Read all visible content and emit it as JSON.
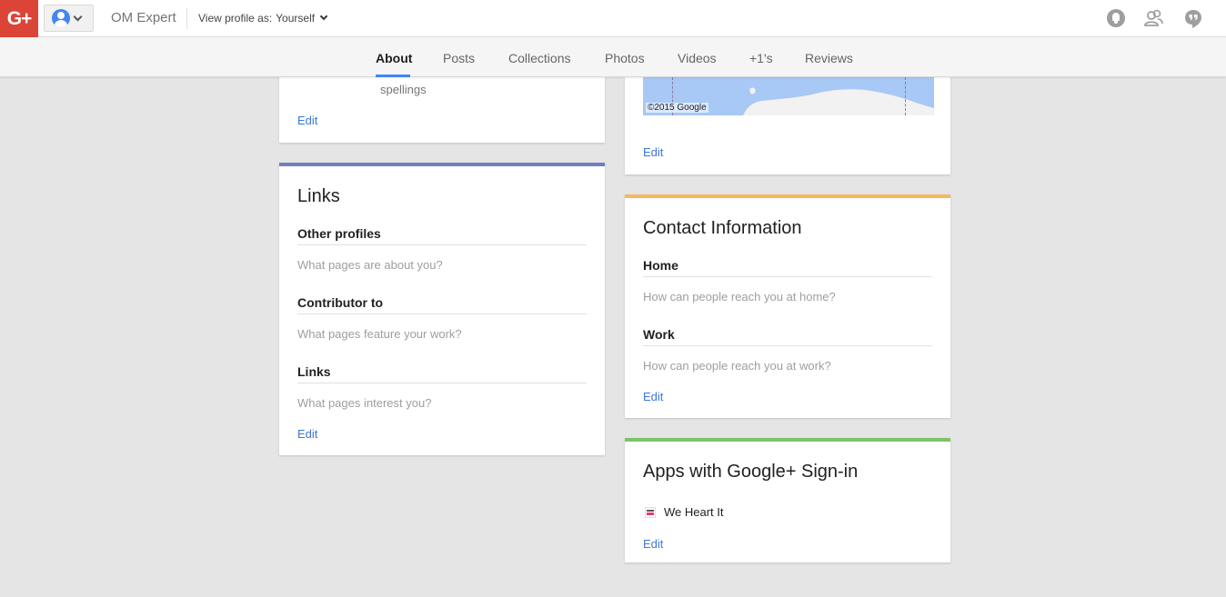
{
  "header": {
    "logo_text": "G+",
    "brand": "OM Expert",
    "view_profile_label": "View profile as:",
    "view_profile_value": "Yourself",
    "icons": [
      "notifications-icon",
      "people-icon",
      "hangouts-icon"
    ]
  },
  "tabs": [
    {
      "label": "About",
      "active": true
    },
    {
      "label": "Posts",
      "active": false
    },
    {
      "label": "Collections",
      "active": false
    },
    {
      "label": "Photos",
      "active": false
    },
    {
      "label": "Videos",
      "active": false
    },
    {
      "label": "+1's",
      "active": false
    },
    {
      "label": "Reviews",
      "active": false
    }
  ],
  "left_top_card": {
    "partial_text": "spellings",
    "edit_label": "Edit"
  },
  "links_card": {
    "accent_color": "#6f7fbd",
    "title": "Links",
    "sections": [
      {
        "label": "Other profiles",
        "hint": "What pages are about you?"
      },
      {
        "label": "Contributor to",
        "hint": "What pages feature your work?"
      },
      {
        "label": "Links",
        "hint": "What pages interest you?"
      }
    ],
    "edit_label": "Edit"
  },
  "places_card": {
    "map_copyright": "©2015 Google",
    "edit_label": "Edit"
  },
  "contact_card": {
    "accent_color": "#f6b95e",
    "title": "Contact Information",
    "sections": [
      {
        "label": "Home",
        "hint": "How can people reach you at home?"
      },
      {
        "label": "Work",
        "hint": "How can people reach you at work?"
      }
    ],
    "edit_label": "Edit"
  },
  "apps_card": {
    "accent_color": "#7dc36b",
    "title": "Apps with Google+ Sign-in",
    "apps": [
      {
        "name": "We Heart It",
        "icon": "we-heart-it-icon"
      }
    ],
    "edit_label": "Edit"
  }
}
